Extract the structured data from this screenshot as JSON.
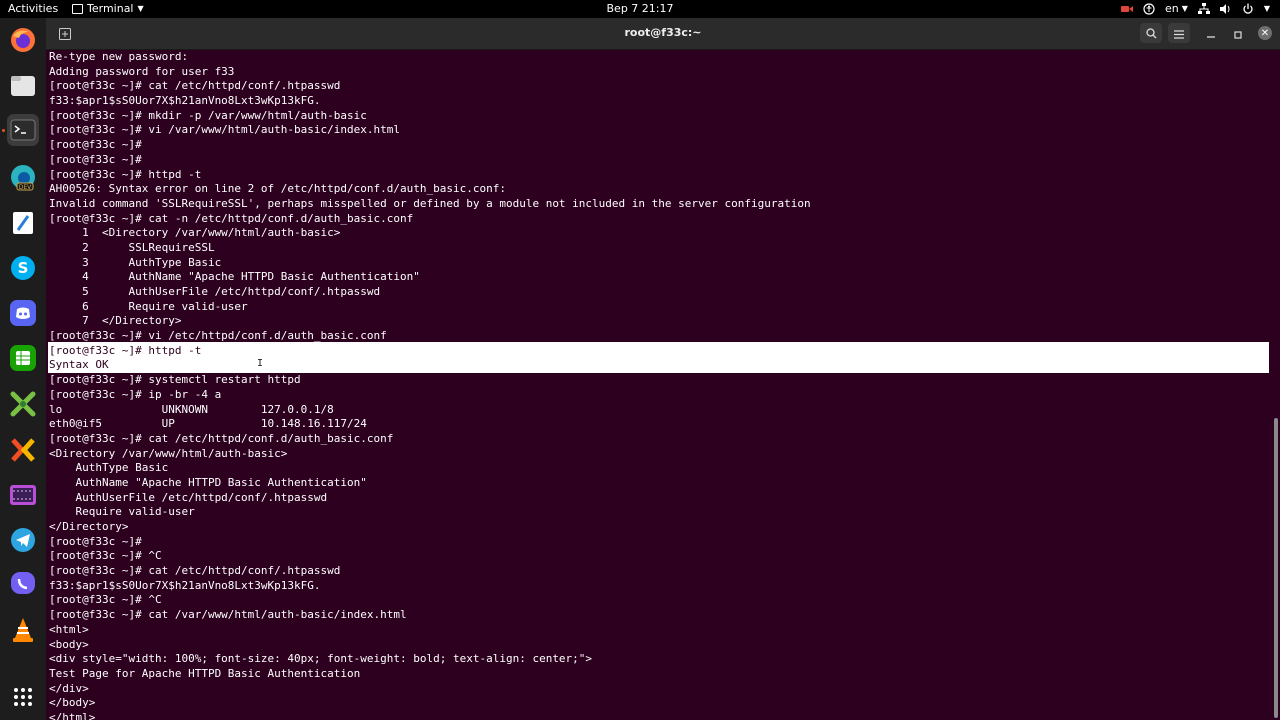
{
  "topbar": {
    "activities": "Activities",
    "app_menu": "Terminal",
    "clock": "Вер 7  21:17",
    "language": "en"
  },
  "window": {
    "title": "root@f33c:~"
  },
  "dock": {
    "items": [
      {
        "name": "firefox-icon",
        "color": "#ff7139"
      },
      {
        "name": "files-icon",
        "color": "#e8e8e8"
      },
      {
        "name": "terminal-icon",
        "color": "#3a3a3a"
      },
      {
        "name": "edge-dev-icon",
        "color": "#2bb3c0"
      },
      {
        "name": "text-editor-icon",
        "color": "#2a7fd4"
      },
      {
        "name": "skype-icon",
        "color": "#00aff0"
      },
      {
        "name": "discord-icon",
        "color": "#5865f2"
      },
      {
        "name": "libreoffice-calc-icon",
        "color": "#18a303"
      },
      {
        "name": "tools-icon",
        "color": "#7ac143"
      },
      {
        "name": "xmind-icon",
        "color": "#f04e23"
      },
      {
        "name": "video-editor-icon",
        "color": "#b84fd6"
      },
      {
        "name": "telegram-icon",
        "color": "#2ca5e0"
      },
      {
        "name": "viber-icon",
        "color": "#7360f2"
      },
      {
        "name": "vlc-icon",
        "color": "#ff8800"
      },
      {
        "name": "show-apps-icon",
        "color": "#ffffff"
      }
    ]
  },
  "terminal": {
    "lines": [
      "Re-type new password:",
      "Adding password for user f33",
      "[root@f33c ~]# cat /etc/httpd/conf/.htpasswd",
      "f33:$apr1$sS0Uor7X$h21anVno8Lxt3wKp13kFG.",
      "[root@f33c ~]# mkdir -p /var/www/html/auth-basic",
      "[root@f33c ~]# vi /var/www/html/auth-basic/index.html",
      "[root@f33c ~]#",
      "[root@f33c ~]#",
      "[root@f33c ~]# httpd -t",
      "AH00526: Syntax error on line 2 of /etc/httpd/conf.d/auth_basic.conf:",
      "Invalid command 'SSLRequireSSL', perhaps misspelled or defined by a module not included in the server configuration",
      "[root@f33c ~]# cat -n /etc/httpd/conf.d/auth_basic.conf",
      "     1  <Directory /var/www/html/auth-basic>",
      "     2      SSLRequireSSL",
      "     3      AuthType Basic",
      "     4      AuthName \"Apache HTTPD Basic Authentication\"",
      "     5      AuthUserFile /etc/httpd/conf/.htpasswd",
      "     6      Require valid-user",
      "     7  </Directory>",
      "[root@f33c ~]# vi /etc/httpd/conf.d/auth_basic.conf",
      "[root@f33c ~]# httpd -t",
      "Syntax OK",
      "[root@f33c ~]# systemctl restart httpd",
      "[root@f33c ~]# ip -br -4 a",
      "lo               UNKNOWN        127.0.0.1/8",
      "eth0@if5         UP             10.148.16.117/24",
      "[root@f33c ~]# cat /etc/httpd/conf.d/auth_basic.conf",
      "<Directory /var/www/html/auth-basic>",
      "    AuthType Basic",
      "    AuthName \"Apache HTTPD Basic Authentication\"",
      "    AuthUserFile /etc/httpd/conf/.htpasswd",
      "    Require valid-user",
      "</Directory>",
      "[root@f33c ~]#",
      "[root@f33c ~]# ^C",
      "[root@f33c ~]# cat /etc/httpd/conf/.htpasswd",
      "f33:$apr1$sS0Uor7X$h21anVno8Lxt3wKp13kFG.",
      "[root@f33c ~]# ^C",
      "[root@f33c ~]# cat /var/www/html/auth-basic/index.html",
      "<html>",
      "<body>",
      "<div style=\"width: 100%; font-size: 40px; font-weight: bold; text-align: center;\">",
      "Test Page for Apache HTTPD Basic Authentication",
      "</div>",
      "</body>",
      "</html>"
    ],
    "selected_line_indices": [
      20,
      21
    ]
  }
}
